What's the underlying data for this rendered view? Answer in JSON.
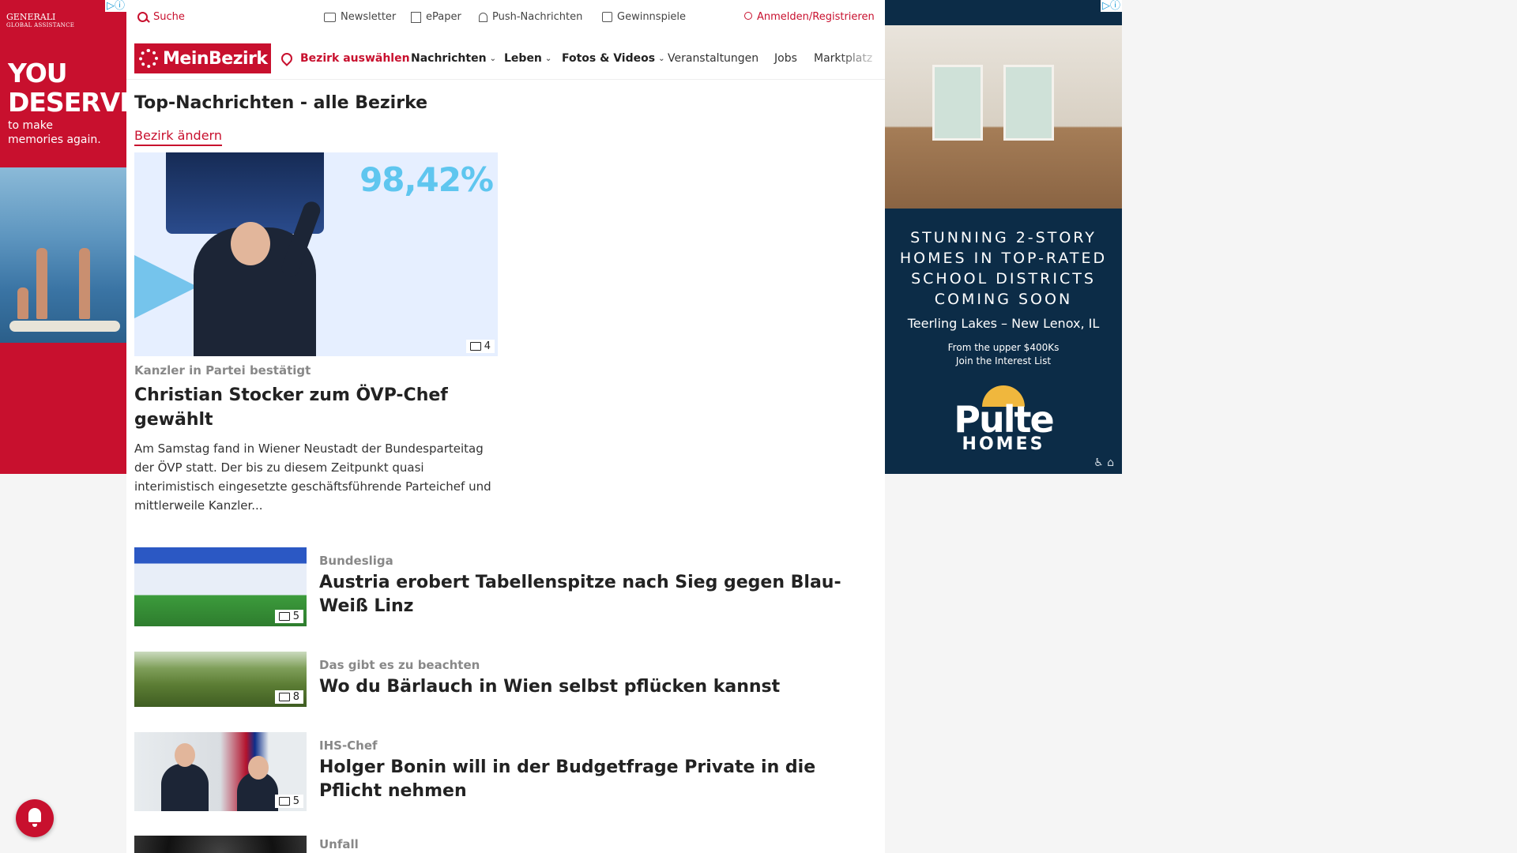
{
  "ads": {
    "left": {
      "brand": "GENERALI",
      "brand_sub": "GLOBAL ASSISTANCE",
      "headline_1": "YOU",
      "headline_2": "DESERVE",
      "sub_1": "to make",
      "sub_2": "memories again."
    },
    "right": {
      "headline": [
        "STUNNING 2-STORY",
        "HOMES IN TOP-RATED",
        "SCHOOL DISTRICTS",
        "COMING SOON"
      ],
      "location": "Teerling Lakes – New Lenox, IL",
      "price_1": "From the upper $400Ks",
      "price_2": "Join the Interest List",
      "logo_big": "Pulte",
      "logo_small": "HOMES"
    }
  },
  "topbar": {
    "search": "Suche",
    "newsletter": "Newsletter",
    "epaper": "ePaper",
    "push": "Push-Nachrichten",
    "gewinnspiele": "Gewinnspiele",
    "login": "Anmelden/Registrieren"
  },
  "nav": {
    "logo": "MeinBezirk",
    "bezirk": "Bezirk auswählen",
    "items": [
      "Nachrichten",
      "Leben",
      "Fotos & Videos",
      "Veranstaltungen",
      "Jobs",
      "Marktplatz"
    ]
  },
  "main": {
    "title": "Top-Nachrichten - alle Bezirke",
    "change_link": "Bezirk ändern",
    "hero": {
      "percent": "98,42%",
      "image_count": "4",
      "kicker": "Kanzler in Partei bestätigt",
      "title": "Christian Stocker zum ÖVP-Chef gewählt",
      "teaser": "Am Samstag fand in Wiener Neustadt der Bundesparteitag der ÖVP statt. Der bis zu diesem Zeitpunkt quasi interimistisch eingesetzte geschäftsführende Parteichef und mittlerweile Kanzler..."
    },
    "articles": [
      {
        "kicker": "Bundesliga",
        "title": "Austria erobert Tabellenspitze nach Sieg gegen Blau-Weiß Linz",
        "count": "5"
      },
      {
        "kicker": "Das gibt es zu beachten",
        "title": "Wo du Bärlauch in Wien selbst pflücken kannst",
        "count": "8"
      },
      {
        "kicker": "IHS-Chef",
        "title": "Holger Bonin will in der Budgetfrage Private in die Pflicht nehmen",
        "count": "5"
      },
      {
        "kicker": "Unfall",
        "title": "",
        "count": ""
      }
    ]
  },
  "colors": {
    "brand": "#c8102e",
    "ad_right_bg": "#0c2c47"
  }
}
